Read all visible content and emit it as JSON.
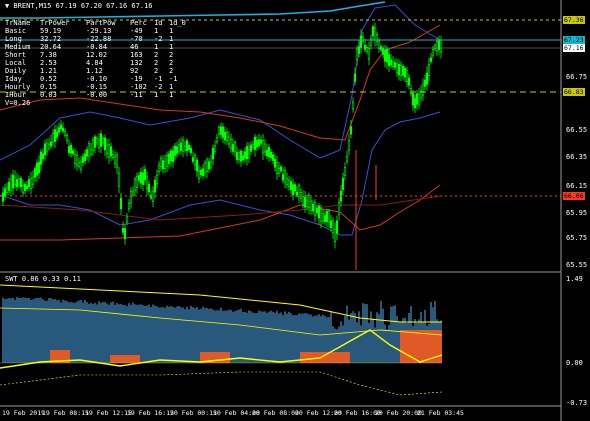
{
  "main_title": "▼ BRENT,M15  67.19 67.20 67.16 67.16",
  "sub_title": "SWT 0.86 0.33 0.11",
  "table": {
    "headers": [
      "TrName",
      "TrPower",
      "PartPow",
      "Perc",
      "1d",
      "1d_0"
    ],
    "rows": [
      [
        "Basic",
        "59.19",
        "-29.13",
        "-49",
        "1",
        "1"
      ],
      [
        "Long",
        "32.72",
        "-22.88",
        "-70",
        "-2",
        "1"
      ],
      [
        "Medium",
        "20.64",
        "-0.84",
        "46",
        "1",
        "1"
      ],
      [
        "Short",
        "7.38",
        "12.02",
        "163",
        "2",
        "2"
      ],
      [
        "Local",
        "2.53",
        "4.84",
        "132",
        "2",
        "2"
      ],
      [
        "Daily",
        "1.21",
        "1.12",
        "92",
        "2",
        "2"
      ],
      [
        "Iday",
        "0.52",
        "-0.10",
        "-19",
        "-1",
        "-1"
      ],
      [
        "Hourly",
        "0.15",
        "-0.15",
        "-102",
        "-2",
        "1"
      ],
      [
        "IHour",
        "0.03",
        "-0.00",
        "-11",
        "1",
        "1"
      ]
    ],
    "footer": "V=0.26"
  },
  "price_axis": [
    "66.75",
    "66.55",
    "66.35",
    "66.15",
    "65.95",
    "65.75",
    "65.55"
  ],
  "price_labels": [
    {
      "text": "67.36",
      "bg": "#c8c800",
      "fg": "#000"
    },
    {
      "text": "67.23",
      "bg": "#0fb7c7",
      "fg": "#000"
    },
    {
      "text": "67.16",
      "bg": "#ffffff",
      "fg": "#000"
    },
    {
      "text": "66.83",
      "bg": "#c8c800",
      "fg": "#000"
    },
    {
      "text": "66.06",
      "bg": "#ff3a1f",
      "fg": "#000"
    }
  ],
  "sub_axis": [
    "1.49",
    "0.00",
    "-0.73"
  ],
  "time_axis": [
    "19 Feb 2019",
    "19 Feb 08:15",
    "19 Feb 12:15",
    "19 Feb 16:15",
    "20 Feb 00:15",
    "20 Feb 04:00",
    "20 Feb 08:00",
    "20 Feb 12:00",
    "20 Feb 16:00",
    "20 Feb 20:00",
    "21 Feb 03:45"
  ],
  "colors": {
    "bull": "#00ff00",
    "bear": "#00ff00",
    "ma_blue": "#3a4fd0",
    "ma_red": "#d23a1a",
    "aqua": "#1ab2e6",
    "sep": "#9a9a9a",
    "hist": "#4a9fe0",
    "orange": "#ff5a1a",
    "yellow": "#ffff00"
  }
}
